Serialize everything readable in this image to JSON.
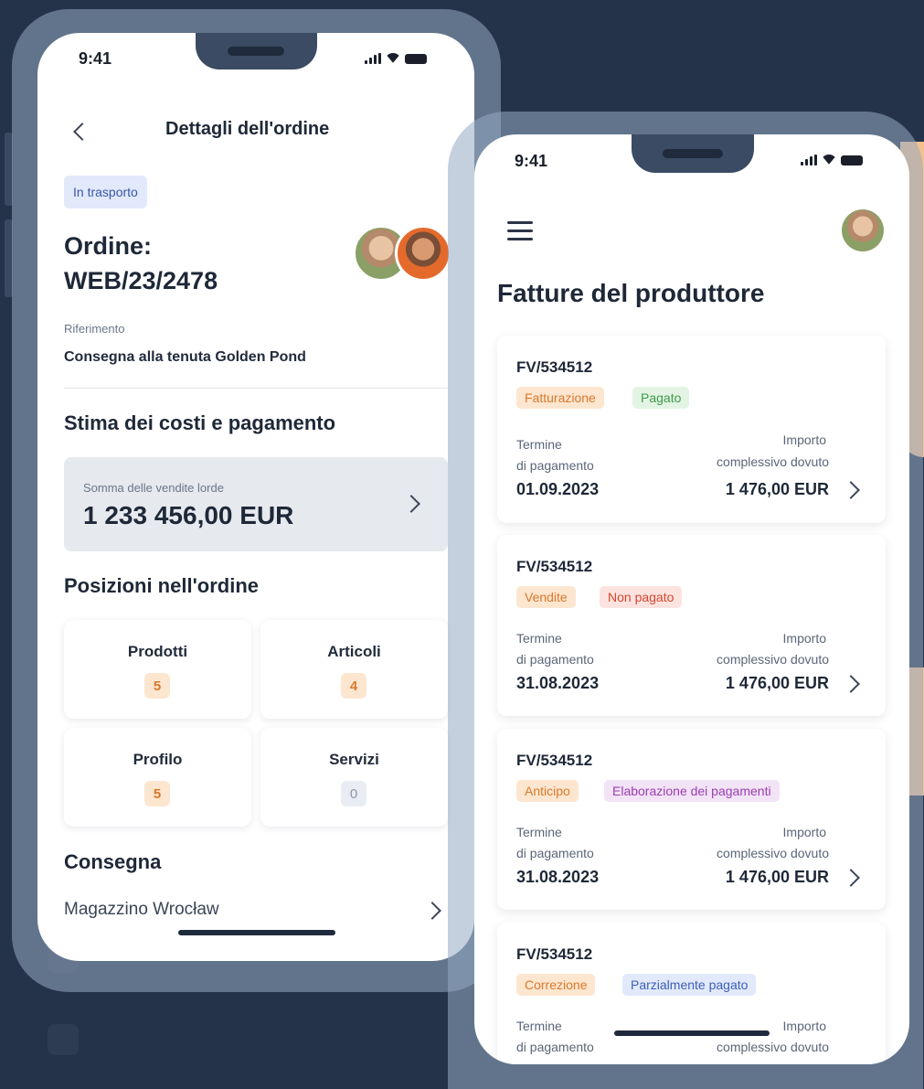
{
  "status_time": "9:41",
  "order_screen": {
    "title": "Dettagli dell'ordine",
    "status_chip": "In trasporto",
    "order_label": "Ordine:",
    "order_number": "WEB/23/2478",
    "reference_label": "Riferimento",
    "reference_value": "Consegna alla tenuta Golden Pond",
    "costs_title": "Stima dei costi e pagamento",
    "gross_sales_label": "Somma delle vendite lorde",
    "gross_sales_value": "1 233 456,00 EUR",
    "positions_title": "Posizioni nell'ordine",
    "positions": [
      {
        "label": "Prodotti",
        "count": "5"
      },
      {
        "label": "Articoli",
        "count": "4"
      },
      {
        "label": "Profilo",
        "count": "5"
      },
      {
        "label": "Servizi",
        "count": "0"
      }
    ],
    "delivery_title": "Consegna",
    "delivery_value": "Magazzino Wrocław"
  },
  "invoices_screen": {
    "title": "Fatture del produttore",
    "due_label_1": "Termine",
    "due_label_2": "di pagamento",
    "amount_label_1": "Importo",
    "amount_label_2": "complessivo dovuto",
    "invoices": [
      {
        "number": "FV/534512",
        "tag1": "Fatturazione",
        "tag2": "Pagato",
        "date": "01.09.2023",
        "amount": "1 476,00 EUR"
      },
      {
        "number": "FV/534512",
        "tag1": "Vendite",
        "tag2": "Non pagato",
        "date": "31.08.2023",
        "amount": "1 476,00 EUR"
      },
      {
        "number": "FV/534512",
        "tag1": "Anticipo",
        "tag2": "Elaborazione dei pagamenti",
        "date": "31.08.2023",
        "amount": "1 476,00 EUR"
      },
      {
        "number": "FV/534512",
        "tag1": "Correzione",
        "tag2": "Parzialmente pagato",
        "date": "",
        "amount": ""
      }
    ]
  },
  "colors": {
    "background": "#25334a",
    "accent_orange": "#f4c18e",
    "tag_orange_bg": "#fde6d0",
    "tag_orange_text": "#d9782a",
    "tag_green_bg": "#e3f4e4",
    "tag_green_text": "#3f9b48",
    "tag_red_bg": "#fde3df",
    "tag_red_text": "#d8452f",
    "tag_purple_bg": "#f2e3f6",
    "tag_purple_text": "#9b3fb0",
    "tag_blue_bg": "#e1e9fb",
    "tag_blue_text": "#3f5fb8"
  }
}
